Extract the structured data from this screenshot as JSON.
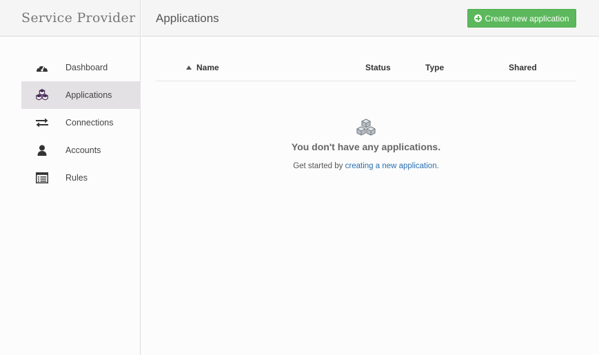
{
  "brand": "Service Provider",
  "header": {
    "title": "Applications",
    "create_button": "Create new application"
  },
  "sidebar": {
    "items": [
      {
        "label": "Dashboard",
        "icon": "dashboard-icon",
        "active": false
      },
      {
        "label": "Applications",
        "icon": "cubes-icon",
        "active": true
      },
      {
        "label": "Connections",
        "icon": "arrows-exchange-icon",
        "active": false
      },
      {
        "label": "Accounts",
        "icon": "user-icon",
        "active": false
      },
      {
        "label": "Rules",
        "icon": "list-icon",
        "active": false
      }
    ]
  },
  "table": {
    "columns": [
      "Name",
      "Status",
      "Type",
      "Shared"
    ],
    "sort": {
      "column": "Name",
      "direction": "ascending"
    }
  },
  "empty_state": {
    "title": "You don't have any applications.",
    "prefix": "Get started by ",
    "link": "creating a new application",
    "suffix": "."
  },
  "colors": {
    "accent_green": "#5cb85c",
    "link_blue": "#2a6fb0",
    "active_item_bg": "#e3e1e3",
    "active_icon": "#4a2c5a"
  }
}
